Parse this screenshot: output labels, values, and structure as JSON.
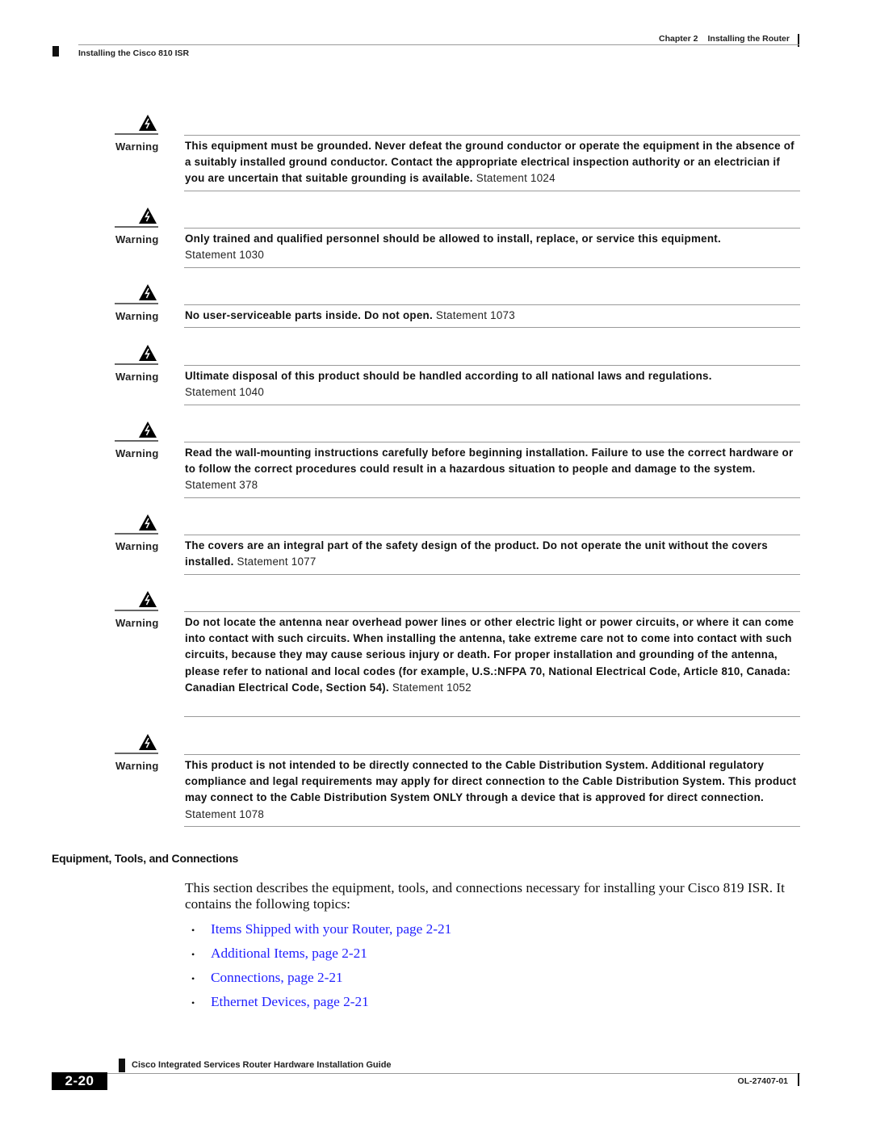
{
  "header": {
    "chapter_label": "Chapter 2",
    "chapter_title": "Installing the Router",
    "section_title": "Installing the Cisco 810 ISR"
  },
  "warnings": [
    {
      "label": "Warning",
      "icon": "warning-electric-shock-icon",
      "text": "This equipment must be grounded. Never defeat the ground conductor or operate the equipment in the absence of a suitably installed ground conductor. Contact the appropriate electrical inspection authority or an electrician if you are uncertain that suitable grounding is available.",
      "statement": "Statement 1024"
    },
    {
      "label": "Warning",
      "icon": "warning-electric-shock-icon",
      "text": "Only trained and qualified personnel should be allowed to install, replace, or service this equipment.",
      "statement": "Statement 1030"
    },
    {
      "label": "Warning",
      "icon": "warning-electric-shock-icon",
      "text": "No user-serviceable parts inside. Do not open.",
      "statement": "Statement 1073"
    },
    {
      "label": "Warning",
      "icon": "warning-electric-shock-icon",
      "text": "Ultimate disposal of this product should be handled according to all national laws and regulations.",
      "statement": "Statement 1040"
    },
    {
      "label": "Warning",
      "icon": "warning-electric-shock-icon",
      "text": "Read the wall-mounting instructions carefully before beginning installation. Failure to use the correct hardware or to follow the correct procedures could result in a hazardous situation to people and damage to the system.",
      "statement": "Statement 378"
    },
    {
      "label": "Warning",
      "icon": "warning-electric-shock-icon",
      "text": "The covers are an integral part of the safety design of the product. Do not operate the unit without the covers installed.",
      "statement": "Statement 1077"
    },
    {
      "label": "Warning",
      "icon": "warning-electric-shock-icon",
      "text": "Do not locate the antenna near overhead power lines or other electric light or power circuits, or where it can come into contact with such circuits. When installing the antenna, take extreme care not to come into contact with such circuits, because they may cause serious injury or death. For proper installation and grounding of the antenna, please refer to national and local codes (for example, U.S.:NFPA 70, National Electrical Code, Article 810, Canada: Canadian Electrical Code, Section 54).",
      "statement": "Statement 1052"
    },
    {
      "label": "Warning",
      "icon": "warning-electric-shock-icon",
      "text": "This product is not intended to be directly connected to the Cable Distribution System. Additional regulatory compliance and legal requirements may apply for direct connection to the Cable Distribution System. This product may connect to the Cable Distribution System ONLY through a device that is approved for direct connection.",
      "statement": "Statement 1078"
    }
  ],
  "section": {
    "heading": "Equipment, Tools, and Connections",
    "intro": "This section describes the equipment, tools, and connections necessary for installing your Cisco 819 ISR. It contains the following topics:",
    "topics": [
      {
        "bullet": "•",
        "label": "Items Shipped with your Router, page 2-21"
      },
      {
        "bullet": "•",
        "label": "Additional Items, page 2-21"
      },
      {
        "bullet": "•",
        "label": "Connections, page 2-21"
      },
      {
        "bullet": "•",
        "label": "Ethernet Devices, page 2-21"
      }
    ],
    "link_color": "#1f1fff"
  },
  "footer": {
    "guide_title": "Cisco Integrated Services Router Hardware Installation Guide",
    "page_number": "2-20",
    "doc_number": "OL-27407-01"
  }
}
